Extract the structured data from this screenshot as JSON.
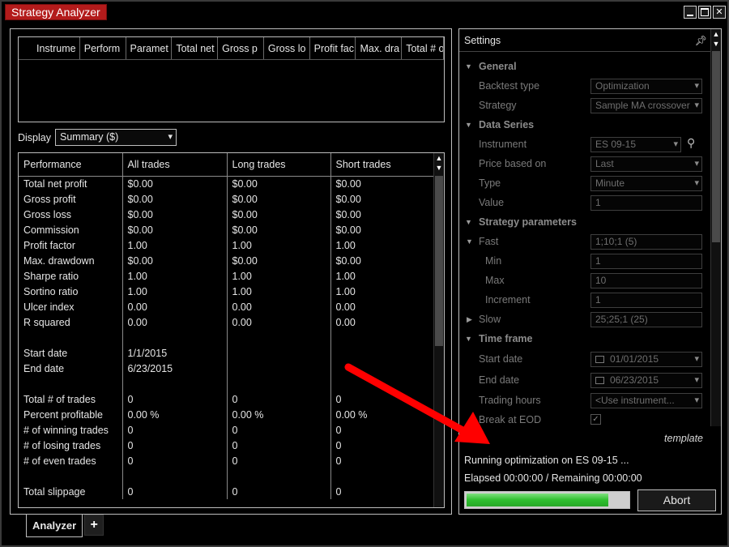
{
  "window": {
    "title": "Strategy Analyzer",
    "buttons": [
      "minimize-icon",
      "maximize-icon",
      "close-icon"
    ]
  },
  "results_grid": {
    "columns": [
      "Instrume",
      "Perform",
      "Paramet",
      "Total net",
      "Gross p",
      "Gross lo",
      "Profit fac",
      "Max. dra",
      "Total # o"
    ]
  },
  "display": {
    "label": "Display",
    "value": "Summary ($)"
  },
  "performance": {
    "headers": [
      "Performance",
      "All trades",
      "Long trades",
      "Short trades"
    ],
    "rows": [
      [
        "Total net profit",
        "$0.00",
        "$0.00",
        "$0.00"
      ],
      [
        "Gross profit",
        "$0.00",
        "$0.00",
        "$0.00"
      ],
      [
        "Gross loss",
        "$0.00",
        "$0.00",
        "$0.00"
      ],
      [
        "Commission",
        "$0.00",
        "$0.00",
        "$0.00"
      ],
      [
        "Profit factor",
        "1.00",
        "1.00",
        "1.00"
      ],
      [
        "Max. drawdown",
        "$0.00",
        "$0.00",
        "$0.00"
      ],
      [
        "Sharpe ratio",
        "1.00",
        "1.00",
        "1.00"
      ],
      [
        "Sortino ratio",
        "1.00",
        "1.00",
        "1.00"
      ],
      [
        "Ulcer index",
        "0.00",
        "0.00",
        "0.00"
      ],
      [
        "R squared",
        "0.00",
        "0.00",
        "0.00"
      ],
      [
        "",
        "",
        "",
        ""
      ],
      [
        "Start date",
        "1/1/2015",
        "",
        ""
      ],
      [
        "End date",
        "6/23/2015",
        "",
        ""
      ],
      [
        "",
        "",
        "",
        ""
      ],
      [
        "Total # of trades",
        "0",
        "0",
        "0"
      ],
      [
        "Percent profitable",
        "0.00 %",
        "0.00 %",
        "0.00 %"
      ],
      [
        "# of winning trades",
        "0",
        "0",
        "0"
      ],
      [
        "# of losing trades",
        "0",
        "0",
        "0"
      ],
      [
        "# of even trades",
        "0",
        "0",
        "0"
      ],
      [
        "",
        "",
        "",
        ""
      ],
      [
        "Total slippage",
        "0",
        "0",
        "0"
      ]
    ]
  },
  "tabs": {
    "active": "Analyzer",
    "add": "+"
  },
  "settings": {
    "title": "Settings",
    "general": {
      "label": "General",
      "backtest_type_label": "Backtest type",
      "backtest_type": "Optimization",
      "strategy_label": "Strategy",
      "strategy": "Sample MA crossover"
    },
    "data_series": {
      "label": "Data Series",
      "instrument_label": "Instrument",
      "instrument": "ES 09-15",
      "price_based_on_label": "Price based on",
      "price_based_on": "Last",
      "type_label": "Type",
      "type": "Minute",
      "value_label": "Value",
      "value": "1"
    },
    "strategy_params": {
      "label": "Strategy parameters",
      "fast_label": "Fast",
      "fast": "1;10;1 (5)",
      "min_label": "Min",
      "min": "1",
      "max_label": "Max",
      "max": "10",
      "increment_label": "Increment",
      "increment": "1",
      "slow_label": "Slow",
      "slow": "25;25;1 (25)"
    },
    "time_frame": {
      "label": "Time frame",
      "start_date_label": "Start date",
      "start_date": "01/01/2015",
      "end_date_label": "End date",
      "end_date": "06/23/2015",
      "trading_hours_label": "Trading hours",
      "trading_hours": "<Use instrument...",
      "break_eod_label": "Break at EOD",
      "break_eod_check": "✓"
    },
    "template": "template"
  },
  "status": {
    "line1": "Running optimization on ES 09-15 ...",
    "line2": "Elapsed 00:00:00 / Remaining 00:00:00",
    "progress": 0.88
  },
  "abort_label": "Abort",
  "colors": {
    "title_bg": "#b31b1b",
    "progress_fill": "#2fbf2f",
    "arrow": "#ff0000"
  }
}
